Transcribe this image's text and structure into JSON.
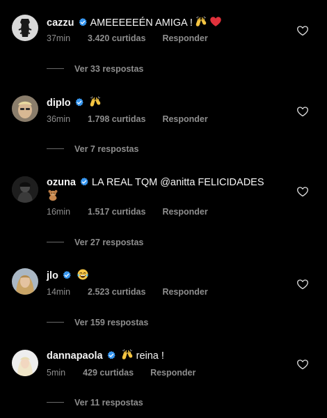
{
  "comments": [
    {
      "username": "cazzu",
      "text": "AMEEEEEÉN AMIGA !",
      "emojis": [
        "raising-hands",
        "red-heart"
      ],
      "time": "37min",
      "likes": "3.420 curtidas",
      "reply": "Responder",
      "view_replies": "Ver 33 respostas"
    },
    {
      "username": "diplo",
      "text": "",
      "emojis": [
        "raising-hands"
      ],
      "time": "36min",
      "likes": "1.798 curtidas",
      "reply": "Responder",
      "view_replies": "Ver 7 respostas"
    },
    {
      "username": "ozuna",
      "text": "LA REAL TQM @anitta FELICIDADES",
      "emojis": [
        "teddy-bear"
      ],
      "time": "16min",
      "likes": "1.517 curtidas",
      "reply": "Responder",
      "view_replies": "Ver 27 respostas"
    },
    {
      "username": "jlo",
      "text": "",
      "emojis": [
        "tears-of-joy"
      ],
      "time": "14min",
      "likes": "2.523 curtidas",
      "reply": "Responder",
      "view_replies": "Ver 159 respostas"
    },
    {
      "username": "dannapaola",
      "text": "reina !",
      "emojis": [
        "raising-hands"
      ],
      "time": "5min",
      "likes": "429 curtidas",
      "reply": "Responder",
      "view_replies": "Ver 11 respostas"
    }
  ],
  "colors": {
    "background": "#000000",
    "text": "#f5f5f5",
    "muted": "#8e8e8e",
    "verified": "#3897f0"
  }
}
